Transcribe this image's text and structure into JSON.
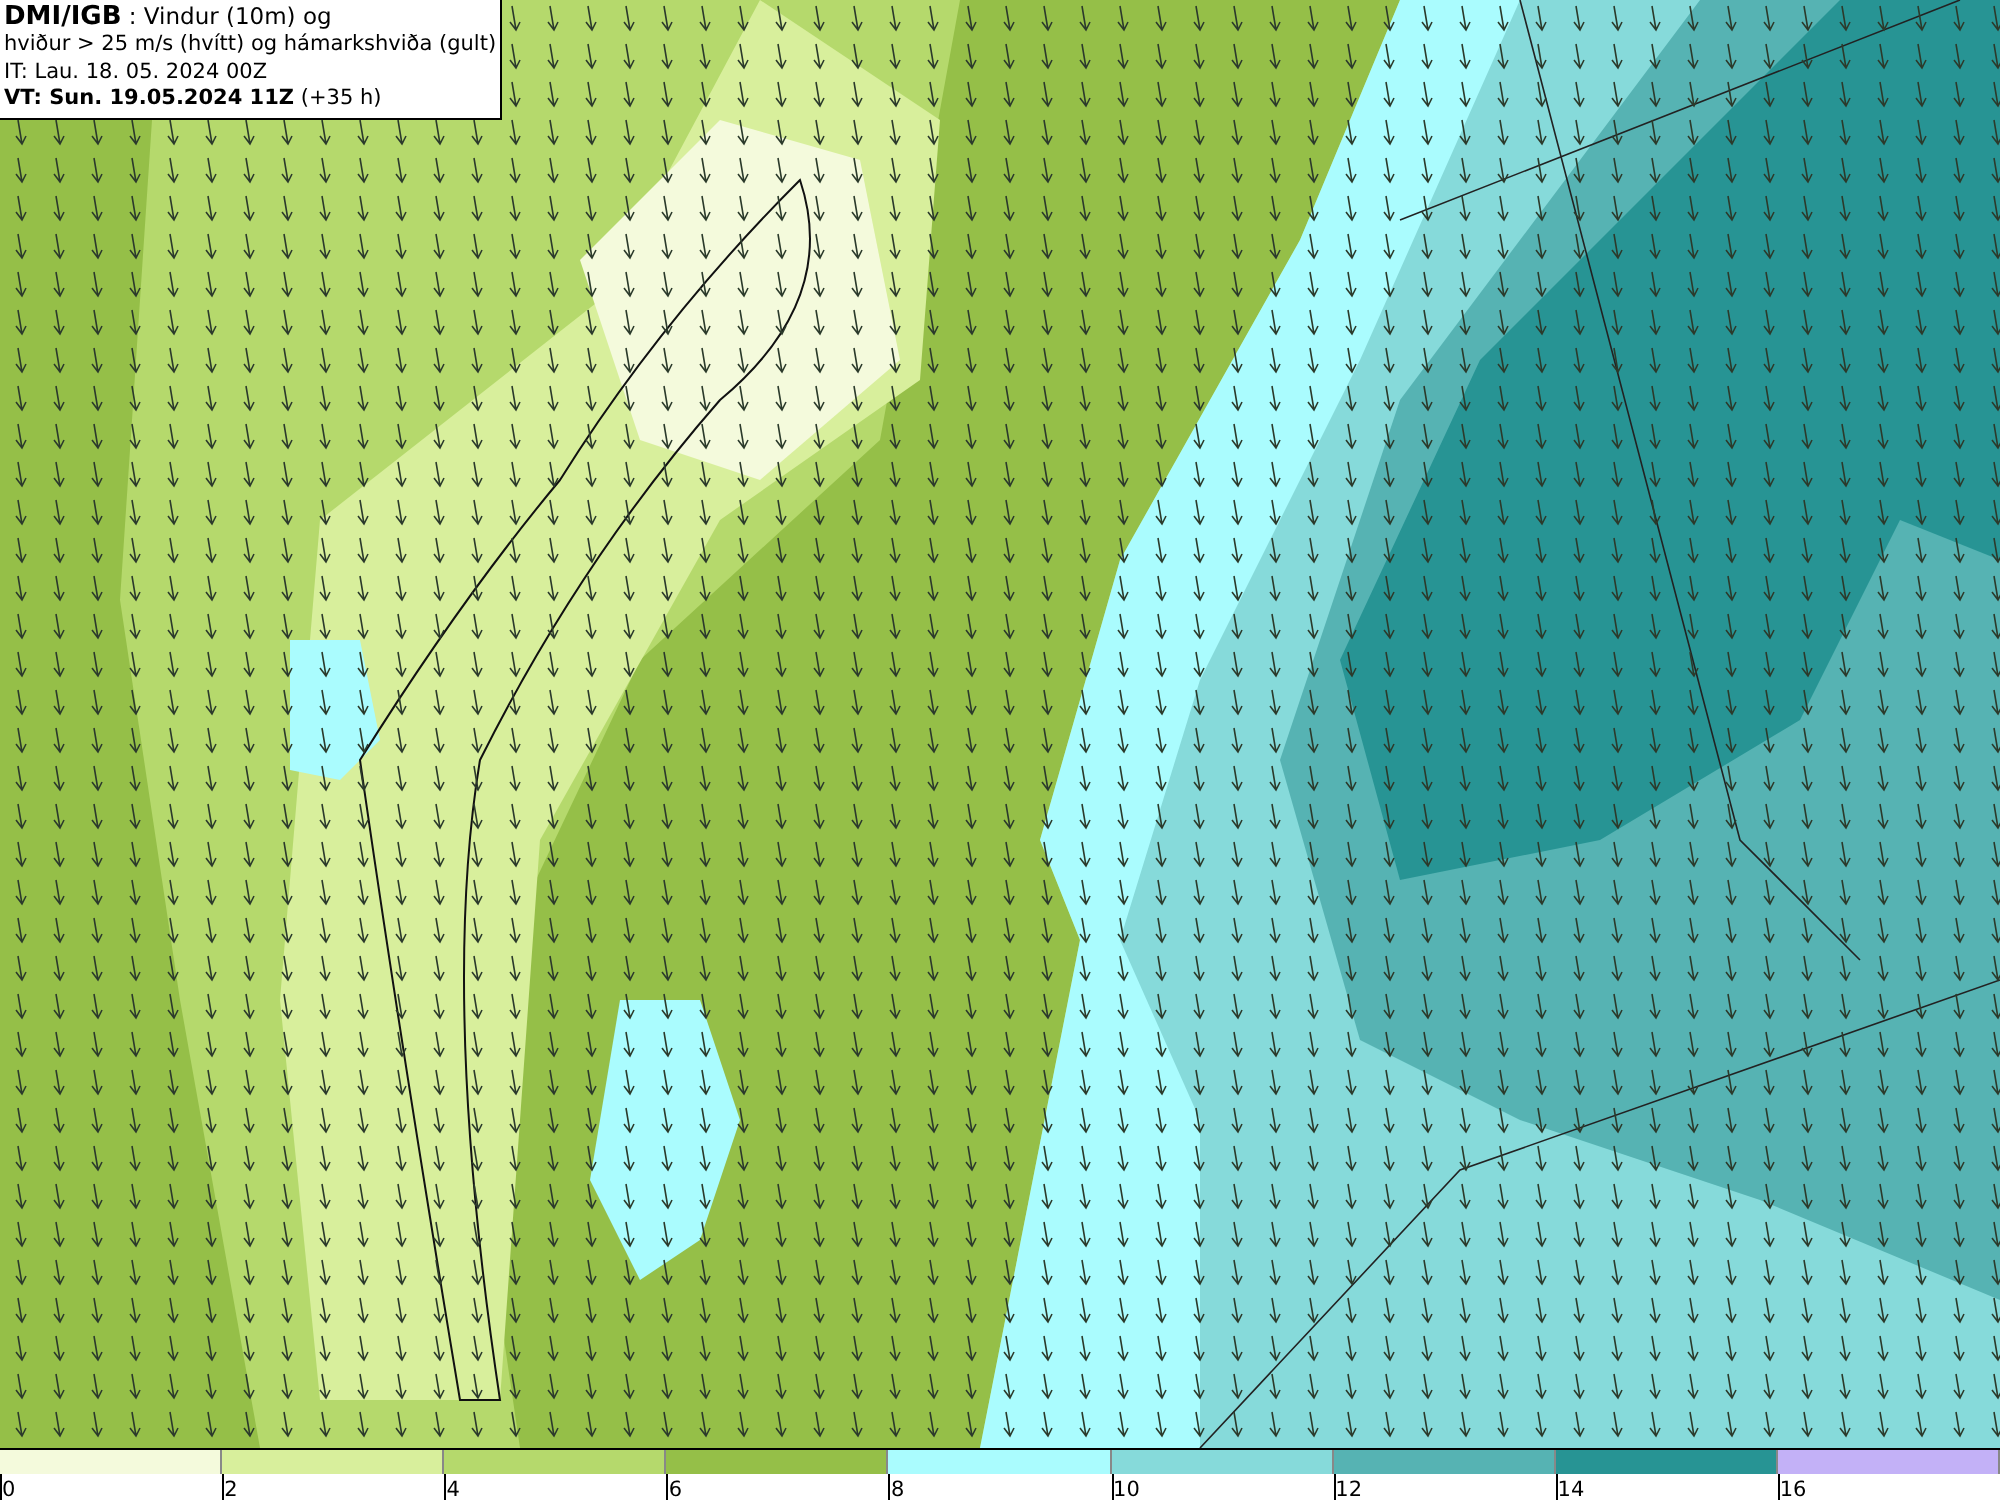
{
  "header": {
    "title": "**DMI/IGB** : Vindur (10m) og",
    "subtitle": "hviður > 25 m/s (hvítt) og hámarkshviða (gult)",
    "issue_time": "IT: Lau. 18. 05. 2024 00Z",
    "valid_time": "**VT: Sun. 19.05.2024 11Z** (+35 h)"
  },
  "legend": [
    {
      "label": "0",
      "color": "#f4fadc"
    },
    {
      "label": "2",
      "color": "#d8ef9c"
    },
    {
      "label": "4",
      "color": "#b5d96c"
    },
    {
      "label": "6",
      "color": "#95bf48"
    },
    {
      "label": "8",
      "color": "#aafcfe"
    },
    {
      "label": "10",
      "color": "#86dada"
    },
    {
      "label": "12",
      "color": "#56b3b3"
    },
    {
      "label": "14",
      "color": "#279494"
    },
    {
      "label": "16",
      "color": "#c3b1f7"
    }
  ]
}
